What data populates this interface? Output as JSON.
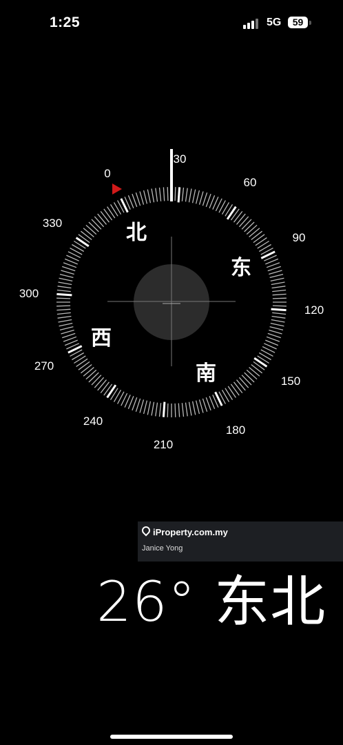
{
  "status_bar": {
    "time": "1:25",
    "network": "5G",
    "battery": "59"
  },
  "compass": {
    "heading_indicator_color": "#d11a1a",
    "degree_labels": [
      "0",
      "30",
      "60",
      "90",
      "120",
      "150",
      "180",
      "210",
      "240",
      "270",
      "300",
      "330"
    ],
    "cardinals": {
      "north": "北",
      "east": "东",
      "south": "南",
      "west": "西"
    }
  },
  "watermark": {
    "brand": "iProperty.com.my",
    "agent": "Janice Yong"
  },
  "heading": {
    "degrees": "26°",
    "direction": "东北"
  }
}
